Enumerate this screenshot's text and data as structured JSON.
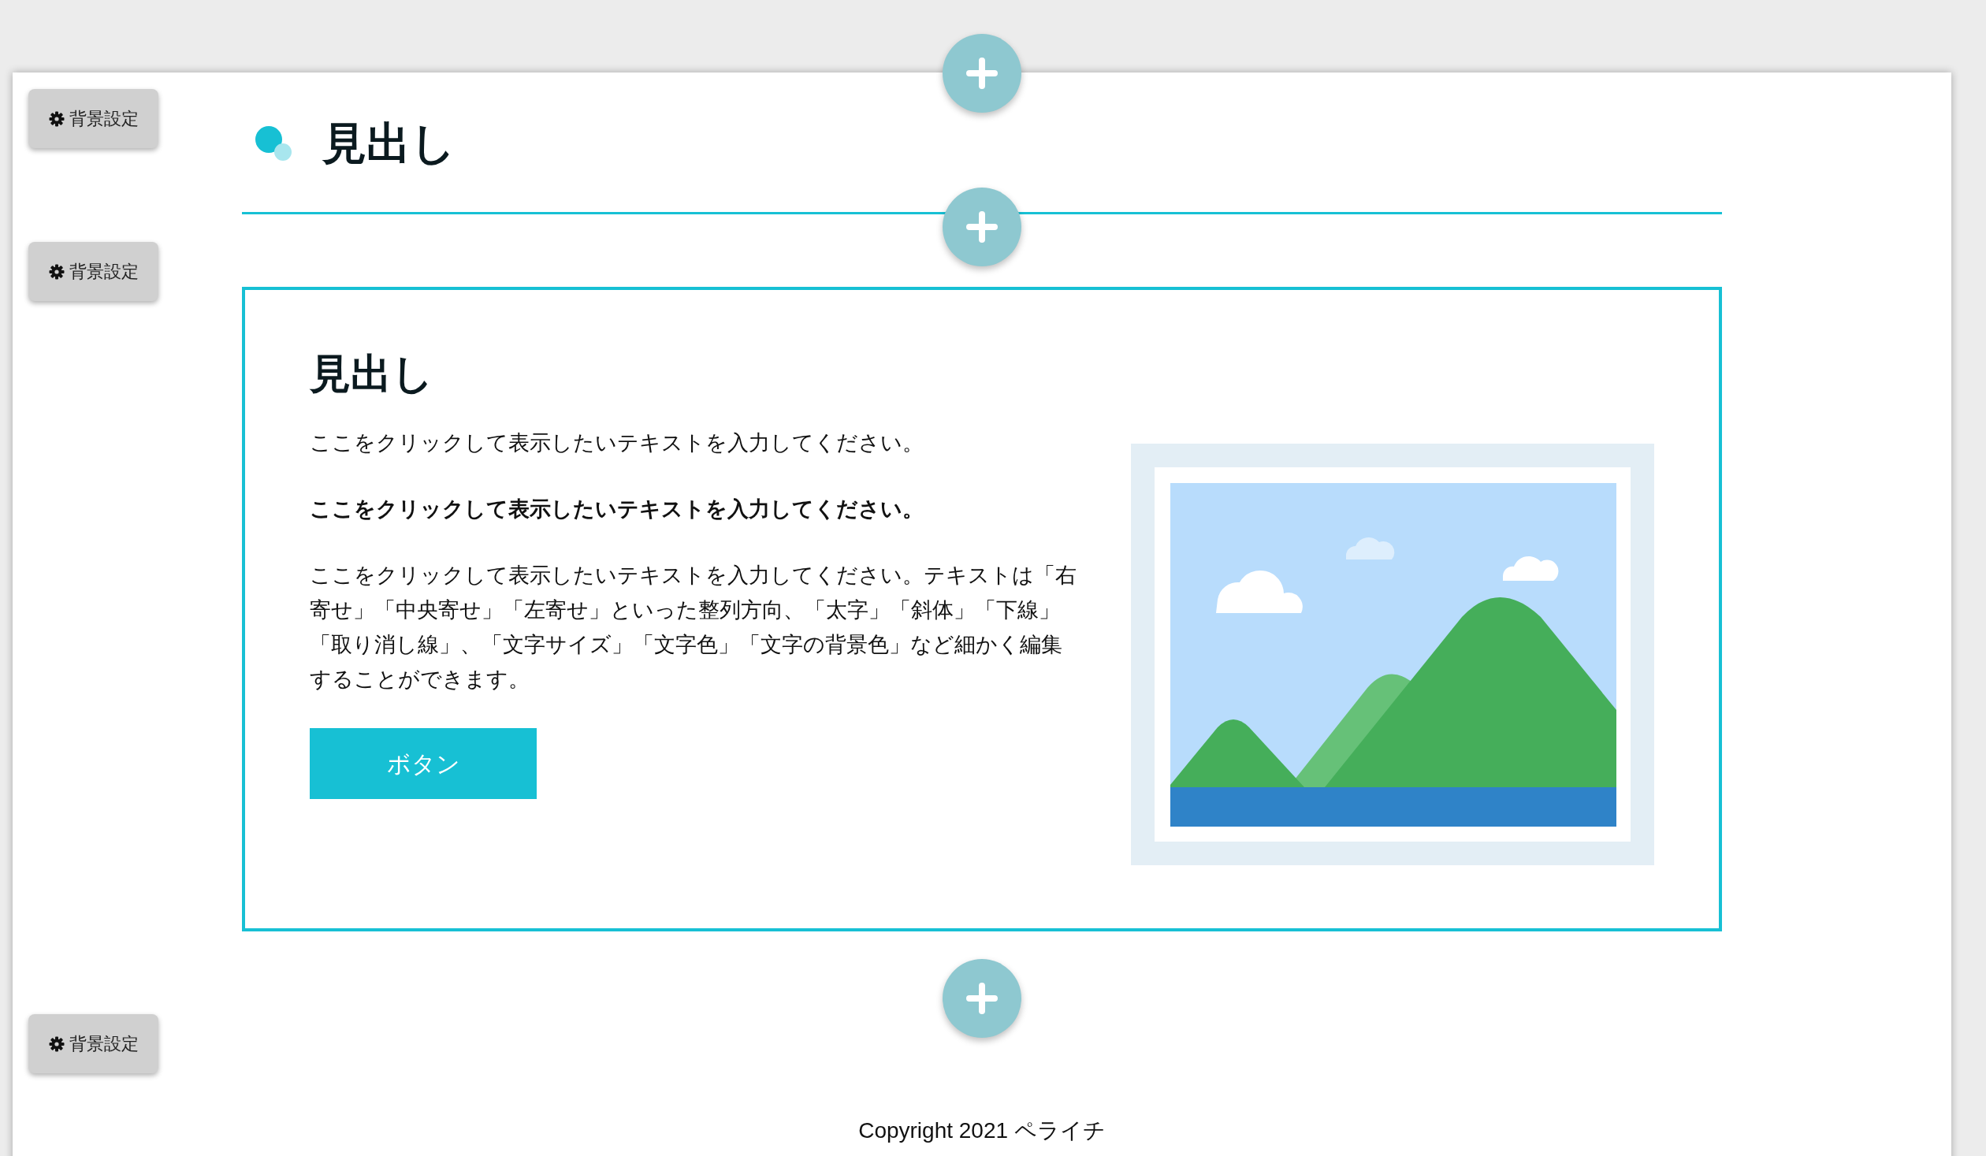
{
  "background_buttons": [
    {
      "label": "背景設定"
    },
    {
      "label": "背景設定"
    },
    {
      "label": "背景設定"
    }
  ],
  "heading_block": {
    "title": "見出し"
  },
  "content_block": {
    "title": "見出し",
    "paragraphs": [
      {
        "text": "ここをクリックして表示したいテキストを入力してください。",
        "bold": false
      },
      {
        "text": "ここをクリックして表示したいテキストを入力してください。",
        "bold": true
      },
      {
        "text": "ここをクリックして表示したいテキストを入力してください。テキストは「右寄せ」「中央寄せ」「左寄せ」といった整列方向、「太字」「斜体」「下線」「取り消し線」、「文字サイズ」「文字色」「文字の背景色」など細かく編集することができます。",
        "bold": false
      }
    ],
    "button": "ボタン"
  },
  "footer": {
    "copyright": "Copyright 2021 ペライチ"
  }
}
